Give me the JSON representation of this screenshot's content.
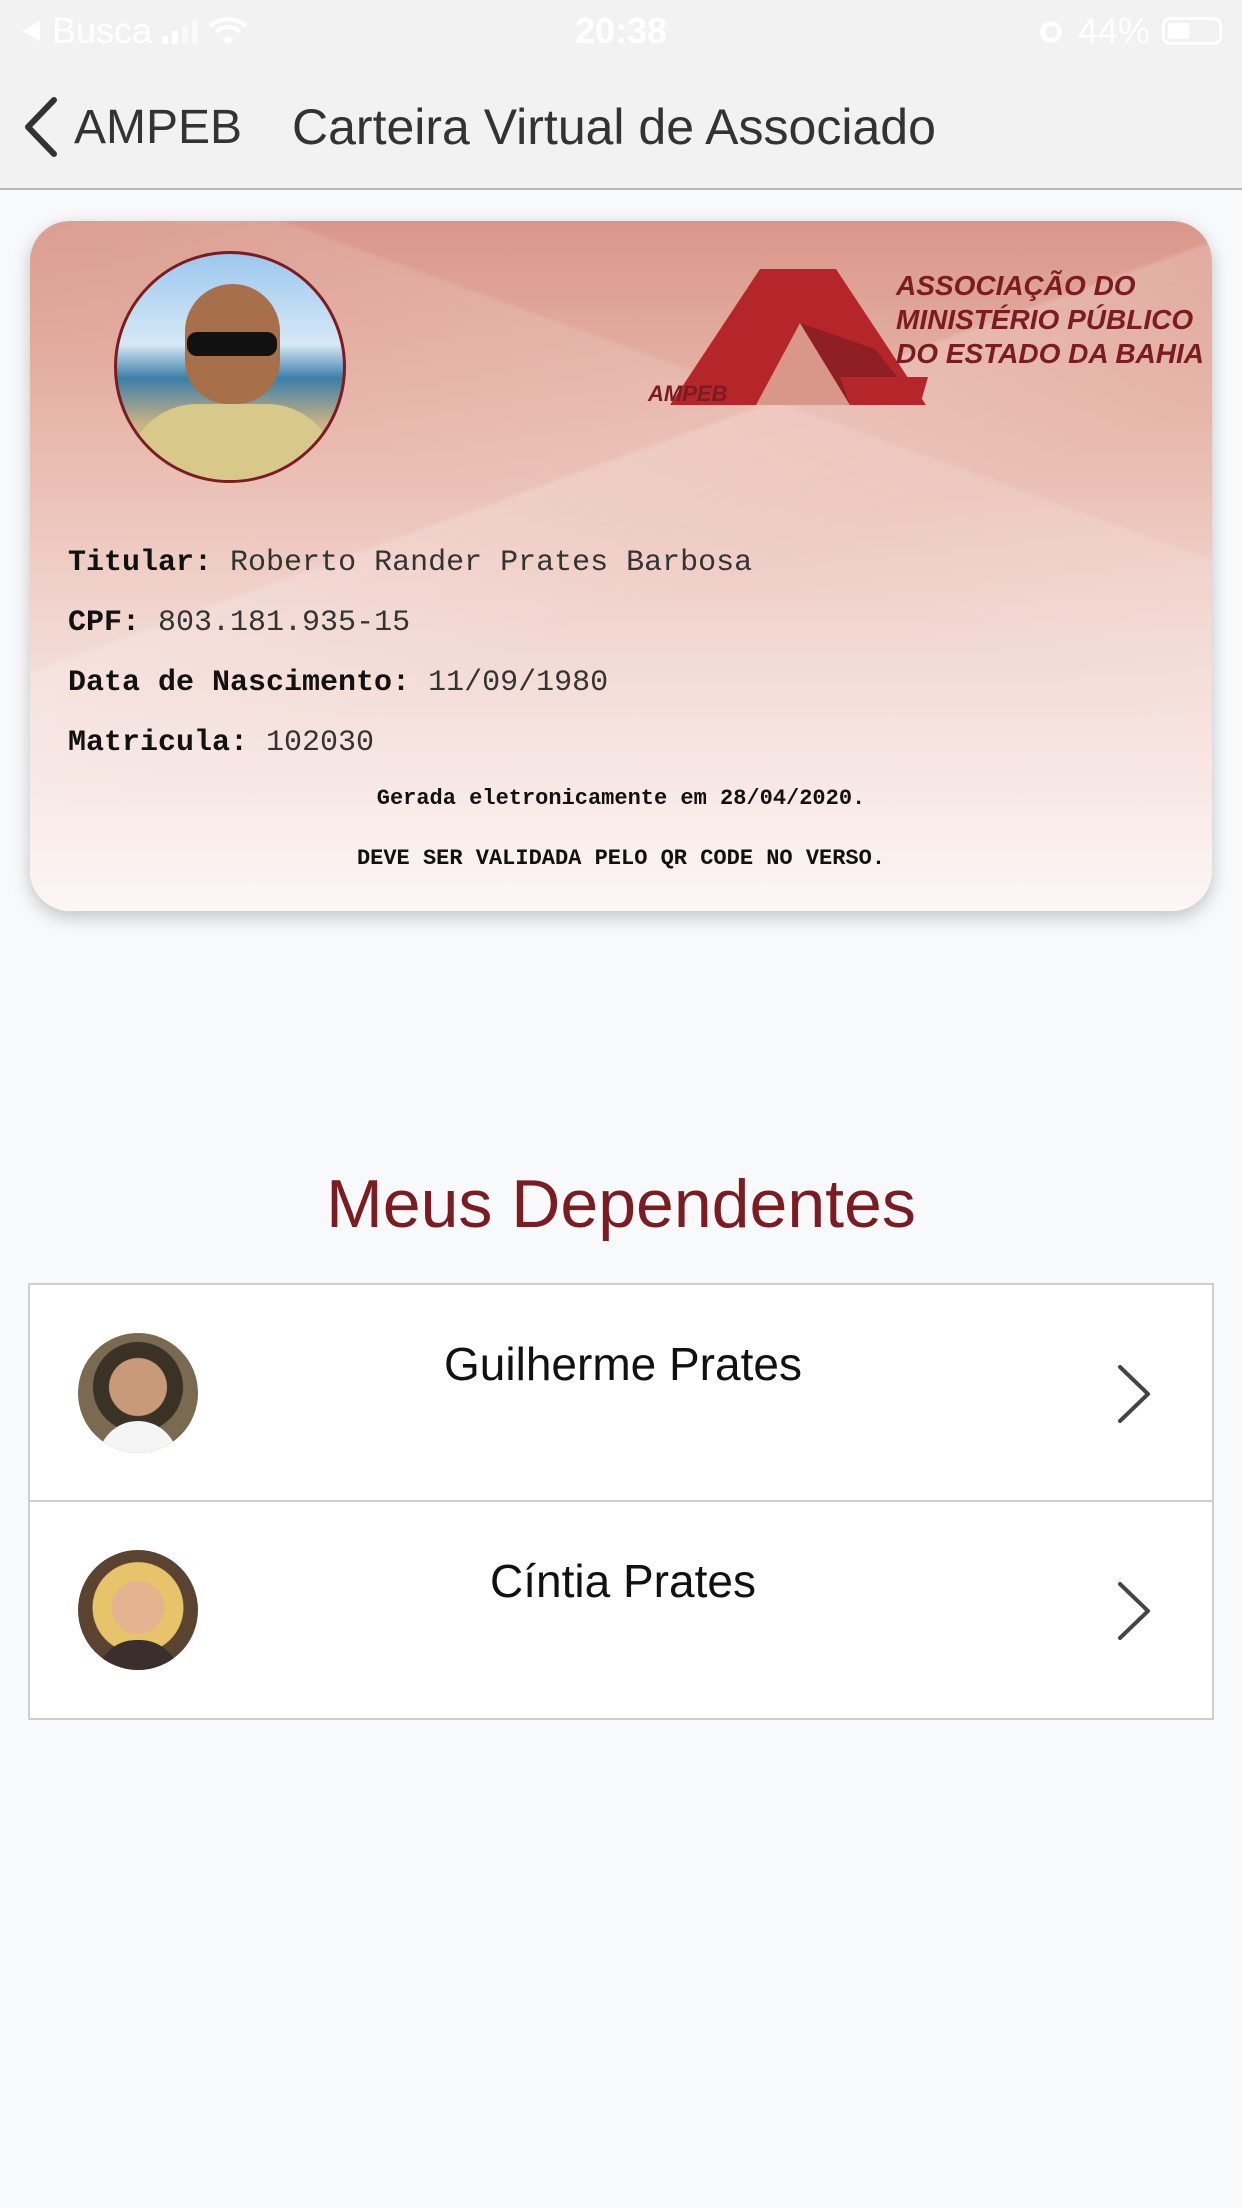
{
  "status_bar": {
    "back_app": "Busca",
    "time": "20:38",
    "battery": "44%",
    "battery_level": 0.44
  },
  "nav": {
    "back_label": "AMPEB",
    "title": "Carteira Virtual de Associado"
  },
  "card": {
    "logo_lines": [
      "ASSOCIAÇÃO DO",
      "MINISTÉRIO PÚBLICO",
      "DO ESTADO DA BAHIA"
    ],
    "logo_abbr": "AMPEB",
    "fields": [
      {
        "label": "Titular:",
        "value": "Roberto Rander Prates Barbosa"
      },
      {
        "label": "CPF:",
        "value": "803.181.935-15"
      },
      {
        "label": "Data de Nascimento:",
        "value": "11/09/1980"
      },
      {
        "label": "Matricula:",
        "value": "102030"
      }
    ],
    "note_generated": "Gerada eletronicamente em 28/04/2020.",
    "note_validate": "DEVE SER VALIDADA PELO QR CODE NO VERSO."
  },
  "dependents": {
    "title": "Meus Dependentes",
    "items": [
      {
        "name": "Guilherme Prates"
      },
      {
        "name": "Cíntia Prates"
      }
    ]
  },
  "colors": {
    "brand": "#7a1c22",
    "background": "#f8f9fb"
  }
}
